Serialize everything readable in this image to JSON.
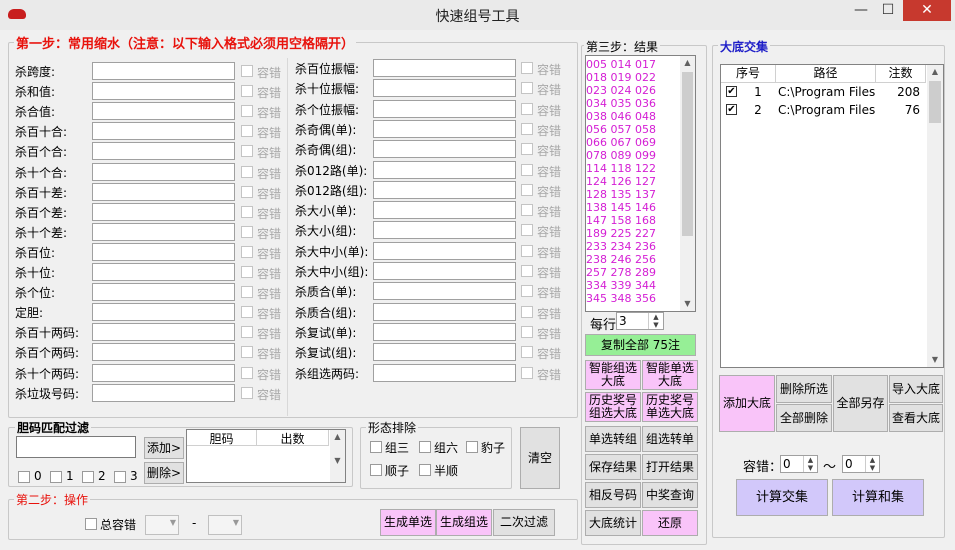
{
  "window": {
    "title": "快速组号工具",
    "minimize": "—",
    "maximize": "☐",
    "close": "✕"
  },
  "step1": {
    "title": "第一步：常用缩水（注意：以下输入格式必须用空格隔开）",
    "tolerance_label": "容错",
    "left_rows": [
      {
        "label": "杀跨度:",
        "value": ""
      },
      {
        "label": "杀和值:",
        "value": ""
      },
      {
        "label": "杀合值:",
        "value": ""
      },
      {
        "label": "杀百十合:",
        "value": ""
      },
      {
        "label": "杀百个合:",
        "value": ""
      },
      {
        "label": "杀十个合:",
        "value": ""
      },
      {
        "label": "杀百十差:",
        "value": ""
      },
      {
        "label": "杀百个差:",
        "value": ""
      },
      {
        "label": "杀十个差:",
        "value": ""
      },
      {
        "label": "杀百位:",
        "value": ""
      },
      {
        "label": "杀十位:",
        "value": ""
      },
      {
        "label": "杀个位:",
        "value": ""
      },
      {
        "label": "定胆:",
        "value": ""
      },
      {
        "label": "杀百十两码:",
        "value": ""
      },
      {
        "label": "杀百个两码:",
        "value": ""
      },
      {
        "label": "杀十个两码:",
        "value": ""
      },
      {
        "label": "杀垃圾号码:",
        "value": ""
      }
    ],
    "right_rows": [
      {
        "label": "杀百位振幅:",
        "value": ""
      },
      {
        "label": "杀十位振幅:",
        "value": ""
      },
      {
        "label": "杀个位振幅:",
        "value": ""
      },
      {
        "label": "杀奇偶(单):",
        "value": ""
      },
      {
        "label": "杀奇偶(组):",
        "value": ""
      },
      {
        "label": "杀012路(单):",
        "value": ""
      },
      {
        "label": "杀012路(组):",
        "value": ""
      },
      {
        "label": "杀大小(单):",
        "value": ""
      },
      {
        "label": "杀大小(组):",
        "value": ""
      },
      {
        "label": "杀大中小(单):",
        "value": ""
      },
      {
        "label": "杀大中小(组):",
        "value": ""
      },
      {
        "label": "杀质合(单):",
        "value": ""
      },
      {
        "label": "杀质合(组):",
        "value": ""
      },
      {
        "label": "杀复试(单):",
        "value": ""
      },
      {
        "label": "杀复试(组):",
        "value": ""
      },
      {
        "label": "杀组选两码:",
        "value": ""
      }
    ]
  },
  "dan": {
    "title": "胆码匹配过滤",
    "input_value": "",
    "add_button": "添加>",
    "delete_button": "删除>",
    "col_dan": "胆码",
    "col_chu": "出数",
    "checks": [
      "0",
      "1",
      "2",
      "3"
    ]
  },
  "shape": {
    "title": "形态排除",
    "items": [
      "组三",
      "组六",
      "豹子",
      "顺子",
      "半顺"
    ]
  },
  "clear_button": "清空",
  "step2": {
    "title": "第二步：操作",
    "total_tolerance": "总容错",
    "dash": "-",
    "btn_single": "生成单选",
    "btn_group": "生成组选",
    "btn_second": "二次过滤"
  },
  "step3": {
    "title": "第三步：结果",
    "results": [
      "005 014 017",
      "018 019 022",
      "023 024 026",
      "034 035 036",
      "038 046 048",
      "056 057 058",
      "066 067 069",
      "078 089 099",
      "114 118 122",
      "124 126 127",
      "128 135 137",
      "138 145 146",
      "147 158 168",
      "189 225 227",
      "233 234 236",
      "238 246 256",
      "257 278 289",
      "334 339 344",
      "345 348 356"
    ],
    "per_row_label": "每行",
    "per_row_value": "3",
    "copy_all": "复制全部 75注",
    "buttons": [
      {
        "label": "智能组选大底",
        "style": "pink"
      },
      {
        "label": "智能单选大底",
        "style": "pink"
      },
      {
        "label": "历史奖号组选大底",
        "style": "pink"
      },
      {
        "label": "历史奖号单选大底",
        "style": "pink"
      },
      {
        "label": "单选转组",
        "style": ""
      },
      {
        "label": "组选转单",
        "style": ""
      },
      {
        "label": "保存结果",
        "style": ""
      },
      {
        "label": "打开结果",
        "style": ""
      },
      {
        "label": "相反号码",
        "style": ""
      },
      {
        "label": "中奖查询",
        "style": ""
      },
      {
        "label": "大底统计",
        "style": ""
      },
      {
        "label": "还原",
        "style": "pink"
      }
    ]
  },
  "dadi": {
    "title": "大底交集",
    "col_no": "序号",
    "col_path": "路径",
    "col_count": "注数",
    "rows": [
      {
        "no": "1",
        "path": "C:\\Program Files",
        "count": "208",
        "checked": true
      },
      {
        "no": "2",
        "path": "C:\\Program Files",
        "count": "76",
        "checked": true
      }
    ],
    "btn_add": "添加大底",
    "btn_del_sel": "删除所选",
    "btn_del_all": "全部删除",
    "btn_save_all": "全部另存",
    "btn_import": "导入大底",
    "btn_view": "查看大底",
    "tolerance_label": "容错：",
    "tolerance_from": "0",
    "tilde": "～",
    "tolerance_to": "0",
    "btn_intersect": "计算交集",
    "btn_union": "计算和集"
  },
  "colors": {
    "red_title": "#e8120c",
    "blue_title": "#1e1ec8",
    "result_text": "#d41ed4",
    "pink_button": "#f9c4f9",
    "green_button": "#96ef96",
    "lavender_button": "#d2c8fa"
  }
}
